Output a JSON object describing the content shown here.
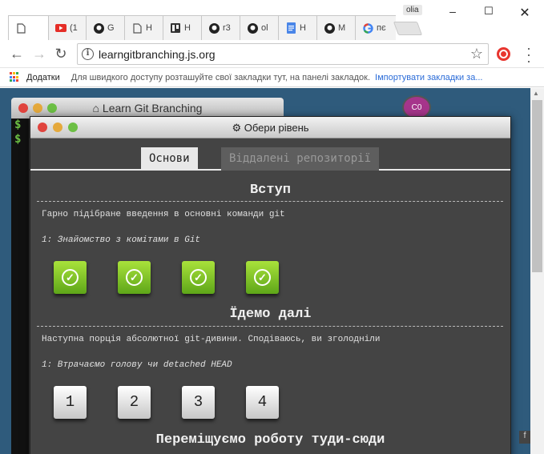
{
  "browser": {
    "profile": "olia",
    "tabs": [
      {
        "icon": "document-icon",
        "label": ""
      },
      {
        "icon": "youtube-icon",
        "label": "(1"
      },
      {
        "icon": "github-icon",
        "label": "G"
      },
      {
        "icon": "document-icon",
        "label": "H"
      },
      {
        "icon": "trello-icon",
        "label": "H"
      },
      {
        "icon": "github-icon",
        "label": "r3"
      },
      {
        "icon": "github-icon",
        "label": "ol"
      },
      {
        "icon": "docs-icon",
        "label": "H"
      },
      {
        "icon": "github-icon",
        "label": "M"
      },
      {
        "icon": "google-icon",
        "label": "пє"
      }
    ],
    "url": "learngitbranching.js.org",
    "bookmarks": {
      "apps": "Додатки",
      "hint": "Для швидкого доступу розташуйте свої закладки тут, на панелі закладок.",
      "import": "Імпортувати закладки за..."
    }
  },
  "app": {
    "terminal_title": "Learn Git Branching",
    "prompt_symbol": "$",
    "avatar_label": "C0",
    "dialog_title": "Обери рівень",
    "tabs": [
      "Основи",
      "Віддалені репозиторії"
    ],
    "sections": [
      {
        "title": "Вступ",
        "description": "Гарно підібране введення в основні команди git",
        "level_name": "1: Знайомство з комітами в Git",
        "levels": [
          "✓",
          "✓",
          "✓",
          "✓"
        ]
      },
      {
        "title": "Їдемо далі",
        "description": "Наступна порція абсолютної git-дивини. Сподіваюсь, ви зголодніли",
        "level_name": "1: Втрачаємо голову чи detached HEAD",
        "levels": [
          "1",
          "2",
          "3",
          "4"
        ]
      },
      {
        "title": "Переміщуємо роботу туди-сюди"
      }
    ]
  },
  "colors": {
    "page_bg": "#2f5b7c",
    "dialog_bg": "#444444",
    "completed_level": "#7cc52a",
    "avatar": "#a6358b"
  }
}
